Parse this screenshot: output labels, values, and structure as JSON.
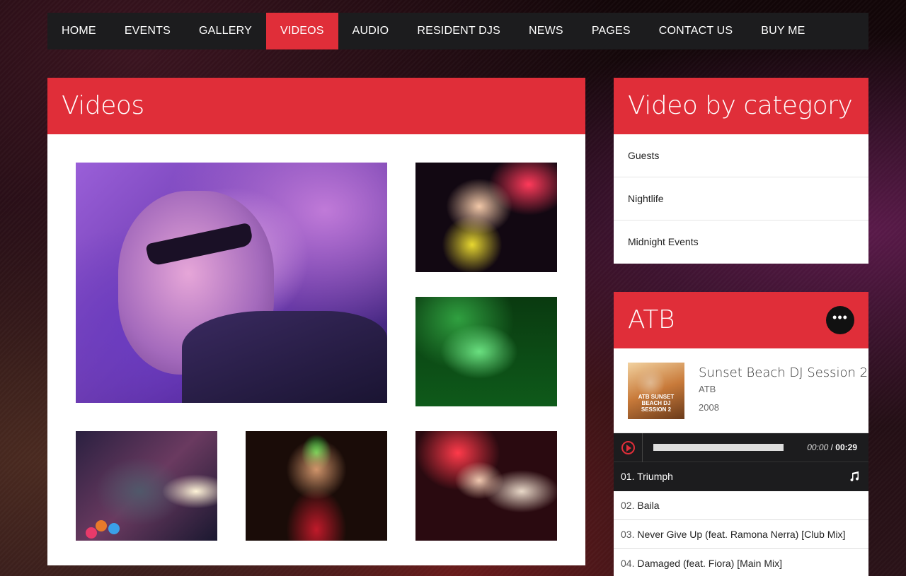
{
  "nav": {
    "items": [
      {
        "label": "HOME"
      },
      {
        "label": "EVENTS"
      },
      {
        "label": "GALLERY"
      },
      {
        "label": "VIDEOS"
      },
      {
        "label": "AUDIO"
      },
      {
        "label": "RESIDENT DJS"
      },
      {
        "label": "NEWS"
      },
      {
        "label": "PAGES"
      },
      {
        "label": "CONTACT US"
      },
      {
        "label": "BUY ME"
      }
    ],
    "active": "VIDEOS"
  },
  "videos": {
    "title": "Videos"
  },
  "categories": {
    "title": "Video by category",
    "items": [
      {
        "label": "Guests"
      },
      {
        "label": "Nightlife"
      },
      {
        "label": "Midnight Events"
      }
    ]
  },
  "player": {
    "artist_title": "ATB",
    "more_icon": "ellipsis-icon",
    "album": {
      "title": "Sunset Beach DJ Session 2",
      "artist": "ATB",
      "year": "2008",
      "cover_text": "ATB SUNSET BEACH DJ SESSION 2"
    },
    "current_time": "00:00",
    "separator": "/",
    "duration": "00:29",
    "progress": 0,
    "tracks": [
      {
        "num": "01.",
        "title": "Triumph",
        "playing": true
      },
      {
        "num": "02.",
        "title": "Baila",
        "playing": false
      },
      {
        "num": "03.",
        "title": "Never Give Up (feat. Ramona Nerra) [Club Mix]",
        "playing": false
      },
      {
        "num": "04.",
        "title": "Damaged (feat. Fiora) [Main Mix]",
        "playing": false
      }
    ]
  },
  "colors": {
    "accent": "#e02e39",
    "dark": "#1c1c1e"
  }
}
